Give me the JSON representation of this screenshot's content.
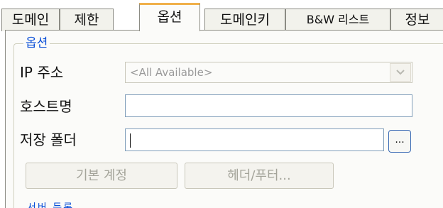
{
  "tabs": [
    {
      "label": "도메인",
      "active": false
    },
    {
      "label": "제한",
      "active": false
    },
    {
      "label": "옵션",
      "active": true
    },
    {
      "label": "도메인키",
      "active": false
    },
    {
      "label": "B&W 리스트",
      "active": false
    },
    {
      "label": "정보",
      "active": false
    }
  ],
  "group": {
    "title": "옵션",
    "ip": {
      "label": "IP 주소",
      "selected": "<All Available>",
      "enabled": false
    },
    "hostname": {
      "label": "호스트명",
      "value": ""
    },
    "folder": {
      "label": "저장 폴더",
      "value": "",
      "browse_label": "..."
    },
    "default_account_button": "기본 계정",
    "header_footer_button": "헤더/푸터..."
  },
  "next_group_label_partial": "서버 등록",
  "colors": {
    "active_tab_accent": "#f0b04a",
    "group_title": "#0a4fd8",
    "disabled_text": "#a4a49a",
    "input_border": "#7f9db9"
  }
}
